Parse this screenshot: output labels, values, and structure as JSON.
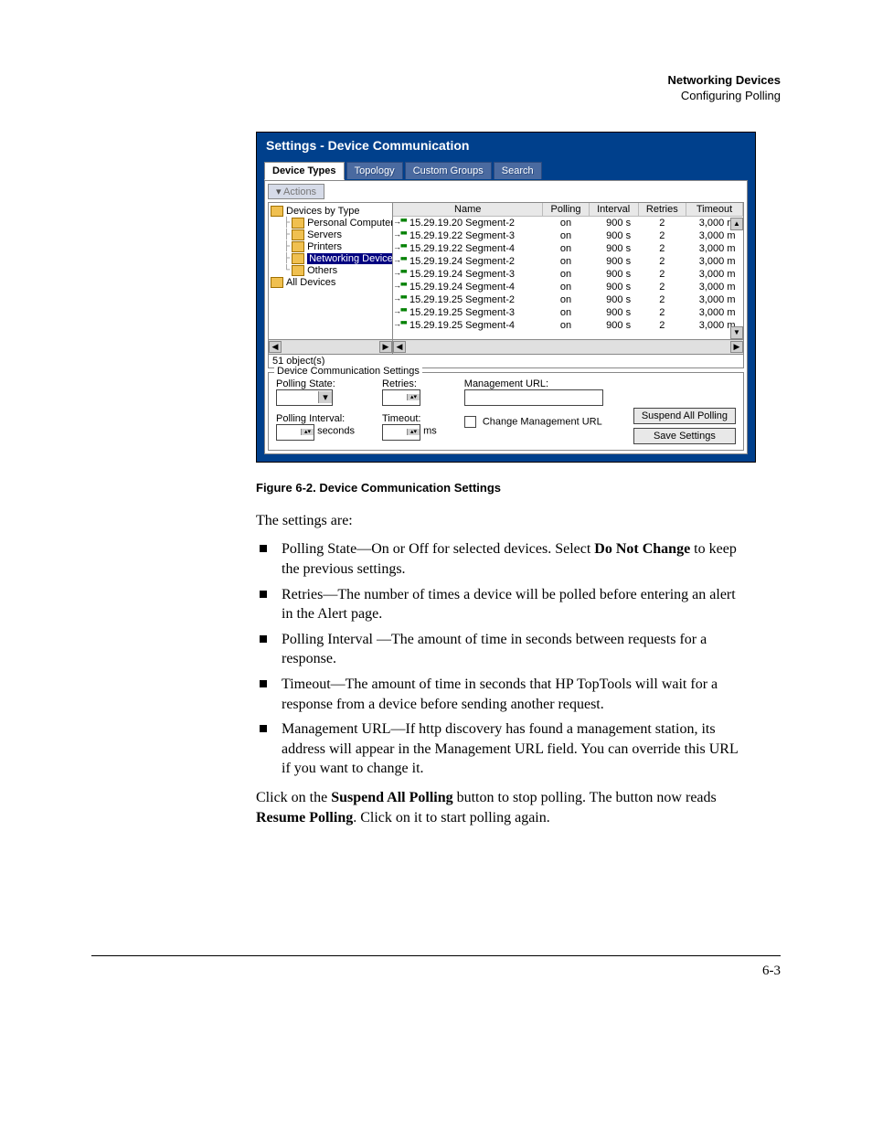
{
  "header": {
    "title": "Networking Devices",
    "subtitle": "Configuring Polling"
  },
  "window": {
    "title": "Settings - Device Communication",
    "tabs": [
      "Device Types",
      "Topology",
      "Custom Groups",
      "Search"
    ],
    "actions_label": "Actions",
    "tree": {
      "root": "Devices by Type",
      "children": [
        "Personal Computers",
        "Servers",
        "Printers",
        "Networking Devices",
        "Others"
      ],
      "selected_index": 3,
      "root2": "All Devices"
    },
    "grid": {
      "headers": [
        "Name",
        "Polling",
        "Interval",
        "Retries",
        "Timeout"
      ],
      "rows": [
        {
          "name": "15.29.19.20 Segment-2",
          "polling": "on",
          "interval": "900 s",
          "retries": "2",
          "timeout": "3,000 m"
        },
        {
          "name": "15.29.19.22 Segment-3",
          "polling": "on",
          "interval": "900 s",
          "retries": "2",
          "timeout": "3,000 m"
        },
        {
          "name": "15.29.19.22 Segment-4",
          "polling": "on",
          "interval": "900 s",
          "retries": "2",
          "timeout": "3,000 m"
        },
        {
          "name": "15.29.19.24 Segment-2",
          "polling": "on",
          "interval": "900 s",
          "retries": "2",
          "timeout": "3,000 m"
        },
        {
          "name": "15.29.19.24 Segment-3",
          "polling": "on",
          "interval": "900 s",
          "retries": "2",
          "timeout": "3,000 m"
        },
        {
          "name": "15.29.19.24 Segment-4",
          "polling": "on",
          "interval": "900 s",
          "retries": "2",
          "timeout": "3,000 m"
        },
        {
          "name": "15.29.19.25 Segment-2",
          "polling": "on",
          "interval": "900 s",
          "retries": "2",
          "timeout": "3,000 m"
        },
        {
          "name": "15.29.19.25 Segment-3",
          "polling": "on",
          "interval": "900 s",
          "retries": "2",
          "timeout": "3,000 m"
        },
        {
          "name": "15.29.19.25 Segment-4",
          "polling": "on",
          "interval": "900 s",
          "retries": "2",
          "timeout": "3,000 m"
        }
      ]
    },
    "status": "51 object(s)",
    "settings_group": {
      "legend": "Device Communication Settings",
      "polling_state_label": "Polling State:",
      "polling_interval_label": "Polling Interval:",
      "polling_interval_unit": "seconds",
      "retries_label": "Retries:",
      "timeout_label": "Timeout:",
      "timeout_unit": "ms",
      "mgmt_url_label": "Management URL:",
      "change_mgmt_label": "Change Management URL",
      "suspend_button": "Suspend All Polling",
      "save_button": "Save Settings"
    }
  },
  "figure_caption": "Figure 6-2.   Device Communication Settings",
  "body": {
    "intro": "The settings are:",
    "bullets": [
      {
        "pre": "Polling State—On or Off for selected devices. Select ",
        "bold": "Do Not Change",
        "post": " to keep the previous settings."
      },
      {
        "pre": "Retries—The number of times a device will be polled before entering an alert in the Alert page.",
        "bold": "",
        "post": ""
      },
      {
        "pre": "Polling Interval —The amount of time in seconds between requests for a response.",
        "bold": "",
        "post": ""
      },
      {
        "pre": "Timeout—The amount of time in seconds that HP TopTools will wait for a response from a device before sending another request.",
        "bold": "",
        "post": ""
      },
      {
        "pre": "Management URL—If http discovery has found a management station, its address will appear in the Management URL field. You can override this URL if you want to change it.",
        "bold": "",
        "post": ""
      }
    ],
    "para_pre": "Click on the ",
    "para_b1": "Suspend All Polling",
    "para_mid": " button to stop polling. The button now reads ",
    "para_b2": "Resume Polling",
    "para_post": ". Click on it to start polling again."
  },
  "page_number": "6-3"
}
